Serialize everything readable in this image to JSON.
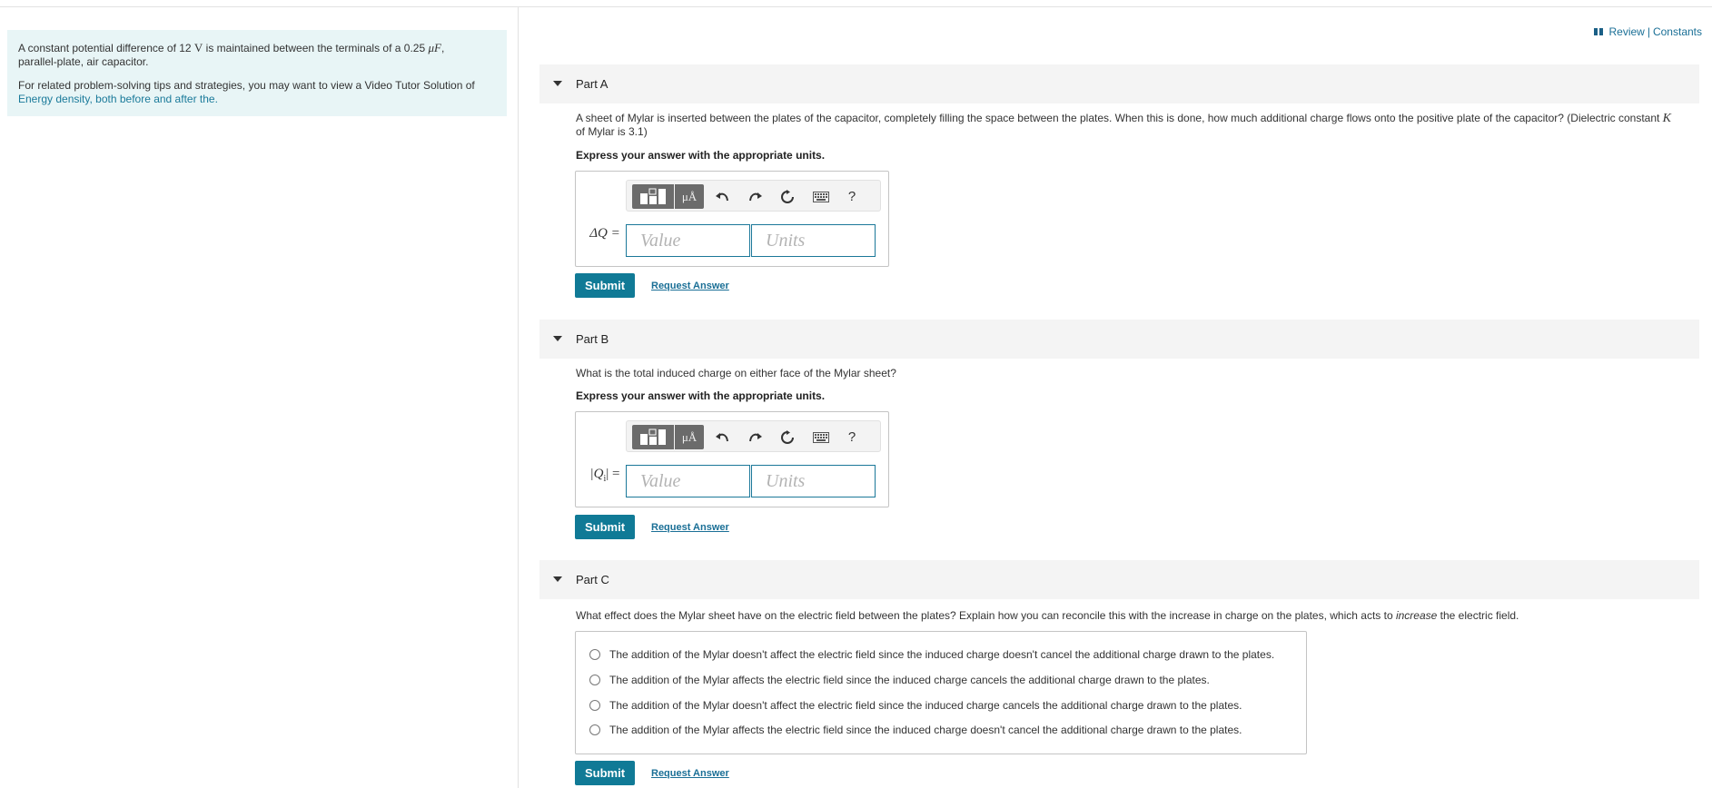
{
  "intro": {
    "p1": {
      "before": "A constant potential difference of 12 ",
      "V": "V",
      "mid": " is maintained between the terminals of a 0.25 ",
      "uF": "μF",
      "after": ",",
      "line2": "parallel-plate, air capacitor."
    },
    "p2": {
      "text": "For related problem-solving tips and strategies, you may want to view a Video Tutor Solution of",
      "link": "Energy density, both before and after the."
    }
  },
  "toplinks": {
    "review": "Review",
    "sep": "|",
    "constants": "Constants"
  },
  "toolbar": {
    "mu": "μÅ",
    "help": "?"
  },
  "common": {
    "instruction": "Express your answer with the appropriate units.",
    "submit": "Submit",
    "request": "Request Answer",
    "value_placeholder": "Value",
    "units_placeholder": "Units"
  },
  "partA": {
    "title": "Part A",
    "q_line1": "A sheet of Mylar is inserted between the plates of the capacitor, completely filling the space between the plates. When this is done, how much additional charge flows onto the positive plate of the capacitor? (Dielectric constant ",
    "q_K": "K",
    "q_line2": "of Mylar is 3.1)",
    "label": "ΔQ ="
  },
  "partB": {
    "title": "Part B",
    "question": "What is the total induced charge on either face of the Mylar sheet?",
    "label_pre": "|Q",
    "label_sub": "i",
    "label_post": "| ="
  },
  "partC": {
    "title": "Part C",
    "q_before": "What effect does the Mylar sheet have on the electric field between the plates? Explain how you can reconcile this with the increase in charge on the plates, which acts to ",
    "q_em": "increase",
    "q_after": " the electric field.",
    "options": [
      "The addition of the Mylar doesn't affect the electric field since the induced charge doesn't cancel the additional charge drawn to the plates.",
      "The addition of the Mylar affects the electric field since the induced charge cancels the additional charge drawn to the plates.",
      "The addition of the Mylar doesn't affect the electric field since the induced charge cancels the additional charge drawn to the plates.",
      "The addition of the Mylar affects the electric field since the induced charge doesn't cancel the additional charge drawn to the plates."
    ]
  },
  "colors": {
    "accent": "#107a96",
    "link": "#1a6f96",
    "intro_bg": "#e8f5f6"
  }
}
